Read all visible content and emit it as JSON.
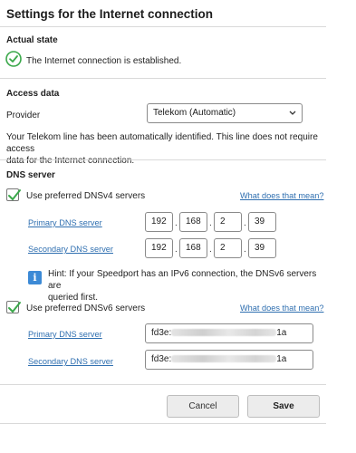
{
  "page": {
    "title": "Settings for the Internet connection"
  },
  "actual_state": {
    "heading": "Actual state",
    "status_text": "The Internet connection is established.",
    "status_color": "#3aa84a"
  },
  "access_data": {
    "heading": "Access data",
    "provider_label": "Provider",
    "provider_value": "Telekom (Automatic)",
    "description_line1": "Your Telekom line has been automatically identified. This line does not require access",
    "description_line2": "data for the Internet connection."
  },
  "dns": {
    "heading": "DNS server",
    "v4": {
      "checkbox_label": "Use preferred DNSv4 servers",
      "checked": true,
      "help_link": "What does that mean?",
      "primary_label": "Primary DNS server",
      "primary": [
        "192",
        "168",
        "2",
        "39"
      ],
      "secondary_label": "Secondary DNS server",
      "secondary": [
        "192",
        "168",
        "2",
        "39"
      ]
    },
    "hint": {
      "icon": "info-icon",
      "line1": "Hint: If your Speedport has an IPv6 connection, the DNSv6 servers are",
      "line2": "queried first."
    },
    "v6": {
      "checkbox_label": "Use preferred DNSv6 servers",
      "checked": true,
      "help_link": "What does that mean?",
      "primary_label": "Primary DNS server",
      "primary_prefix": "fd3e:",
      "primary_suffix": "1a",
      "secondary_label": "Secondary DNS server",
      "secondary_prefix": "fd3e:",
      "secondary_suffix": "1a"
    }
  },
  "buttons": {
    "cancel": "Cancel",
    "save": "Save"
  },
  "colors": {
    "link": "#2f6fb0",
    "check": "#3aa84a",
    "info": "#3c8ad6"
  }
}
